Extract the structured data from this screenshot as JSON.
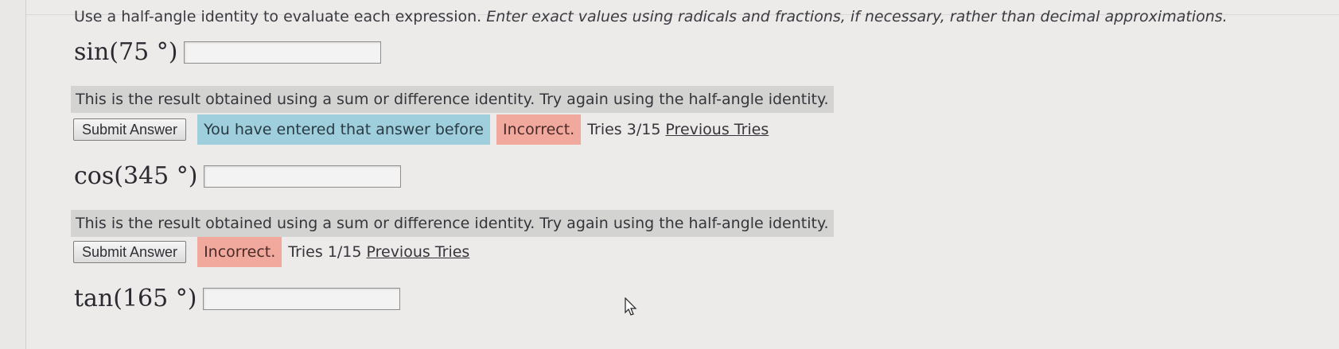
{
  "instructions": {
    "plain": "Use a half-angle identity to evaluate each expression.",
    "italic": "Enter exact values using radicals and fractions, if necessary, rather than decimal approximations."
  },
  "questions": [
    {
      "expression": "sin(75 °)",
      "answer_value": "",
      "feedback": "This is the result obtained using a sum or difference identity. Try again using the half-angle identity.",
      "submit_label": "Submit Answer",
      "repeat_message": "You have entered that answer before",
      "result": "Incorrect.",
      "tries": "Tries 3/15",
      "previous_tries": "Previous Tries"
    },
    {
      "expression": "cos(345 °)",
      "answer_value": "",
      "feedback": "This is the result obtained using a sum or difference identity. Try again using the half-angle identity.",
      "submit_label": "Submit Answer",
      "result": "Incorrect.",
      "tries": "Tries 1/15",
      "previous_tries": "Previous Tries"
    },
    {
      "expression": "tan(165 °)",
      "answer_value": ""
    }
  ],
  "colors": {
    "repeat_bg": "#9fcfdc",
    "incorrect_bg": "#f2a99d",
    "feedback_bg": "#d3d3d1"
  },
  "icons": {
    "cursor": "mouse-pointer-icon"
  }
}
